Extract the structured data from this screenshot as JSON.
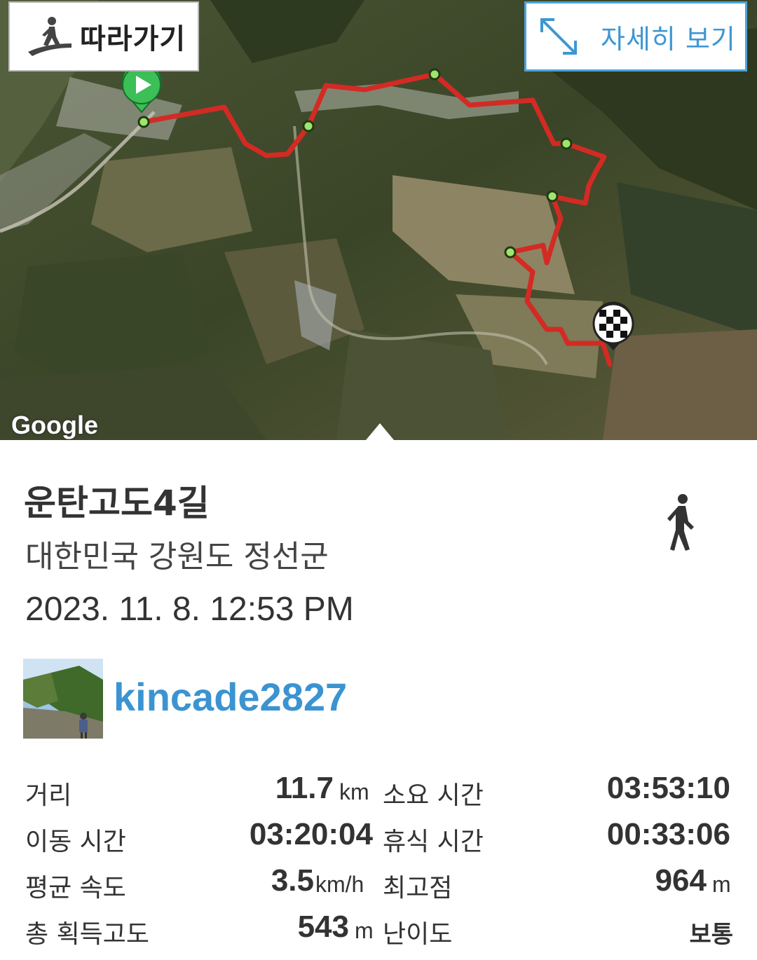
{
  "map": {
    "follow_label": "따라가기",
    "detail_label": "자세히 보기",
    "attribution": "Google",
    "route_color": "#d42a24",
    "accent_color": "#3d97d3"
  },
  "trail": {
    "title": "운탄고도4길",
    "location": "대한민국 강원도 정선군",
    "datetime": "2023. 11. 8. 12:53 PM",
    "activity_icon": "walking-person-icon"
  },
  "user": {
    "name": "kincade2827"
  },
  "stats": {
    "distance": {
      "label": "거리",
      "value": "11.7",
      "unit": "km"
    },
    "total_time": {
      "label": "소요 시간",
      "value": "03:53:10"
    },
    "moving_time": {
      "label": "이동 시간",
      "value": "03:20:04"
    },
    "rest_time": {
      "label": "휴식 시간",
      "value": "00:33:06"
    },
    "avg_speed": {
      "label": "평균 속도",
      "value": "3.5",
      "unit": "km/h"
    },
    "max_elevation": {
      "label": "최고점",
      "value": "964",
      "unit": "m"
    },
    "elevation_gain": {
      "label": "총 획득고도",
      "value": "543",
      "unit": "m"
    },
    "difficulty": {
      "label": "난이도",
      "value": "보통"
    }
  }
}
